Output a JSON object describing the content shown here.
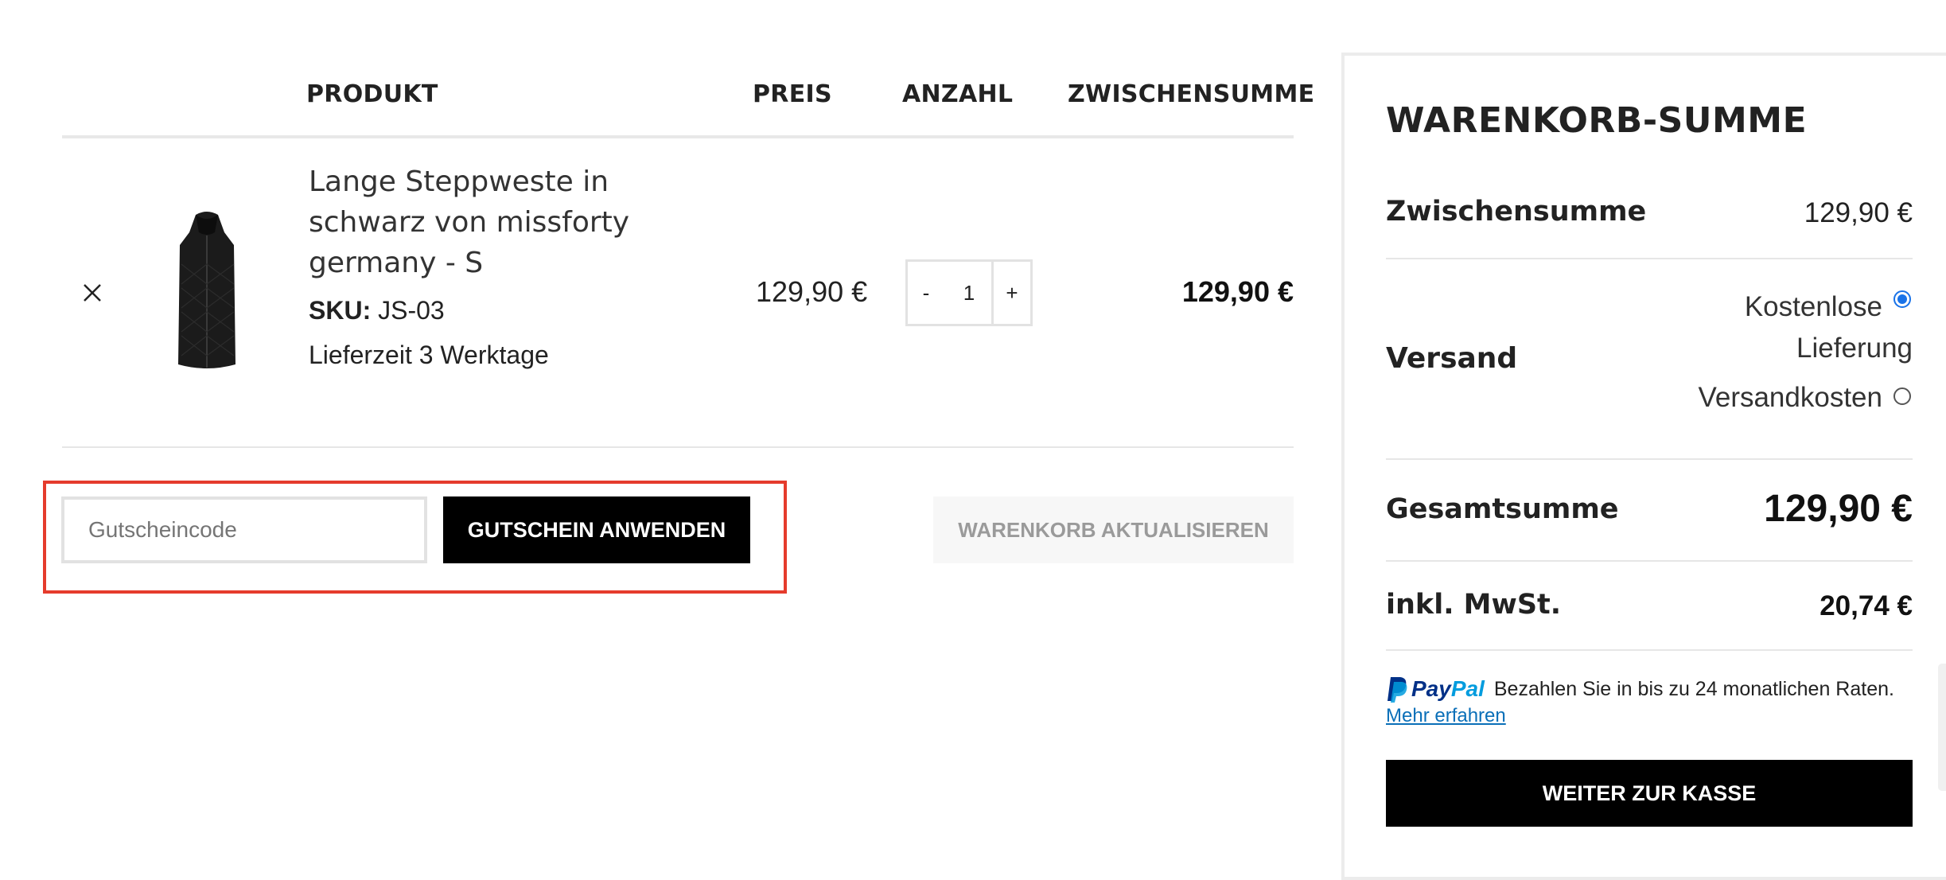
{
  "table": {
    "headers": {
      "product": "PRODUKT",
      "price": "PREIS",
      "quantity": "ANZAHL",
      "subtotal": "ZWISCHENSUMME"
    },
    "item": {
      "name_line1": "Lange Steppweste in",
      "name_line2": "schwarz von missforty",
      "name_line3": "germany - S",
      "sku_label": "SKU:",
      "sku_value": "JS-03",
      "delivery": "Lieferzeit 3 Werktage",
      "price": "129,90 €",
      "qty_minus": "-",
      "qty_value": "1",
      "qty_plus": "+",
      "subtotal": "129,90 €"
    }
  },
  "coupon": {
    "placeholder": "Gutscheincode",
    "apply_label": "GUTSCHEIN ANWENDEN"
  },
  "update_cart_label": "WARENKORB AKTUALISIEREN",
  "totals": {
    "title": "WARENKORB-SUMME",
    "subtotal_label": "Zwischensumme",
    "subtotal_value": "129,90 €",
    "shipping_label": "Versand",
    "shipping_options": [
      {
        "label_line1": "Kostenlose",
        "label_line2": "Lieferung",
        "selected": true
      },
      {
        "label_line1": "Versandkosten",
        "selected": false
      }
    ],
    "total_label": "Gesamtsumme",
    "total_value": "129,90 €",
    "vat_label": "inkl. MwSt.",
    "vat_value": "20,74 €",
    "paypal_brand_pay": "Pay",
    "paypal_brand_pal": "Pal",
    "paypal_text": "Bezahlen Sie in bis zu 24 monatlichen Raten.",
    "paypal_link": "Mehr erfahren",
    "checkout_label": "WEITER ZUR KASSE"
  },
  "colors": {
    "accent_highlight": "#e53b2c",
    "radio_selected": "#1a73e8",
    "paypal_dark": "#003087",
    "paypal_light": "#009cde",
    "link": "#0a6fb8"
  }
}
